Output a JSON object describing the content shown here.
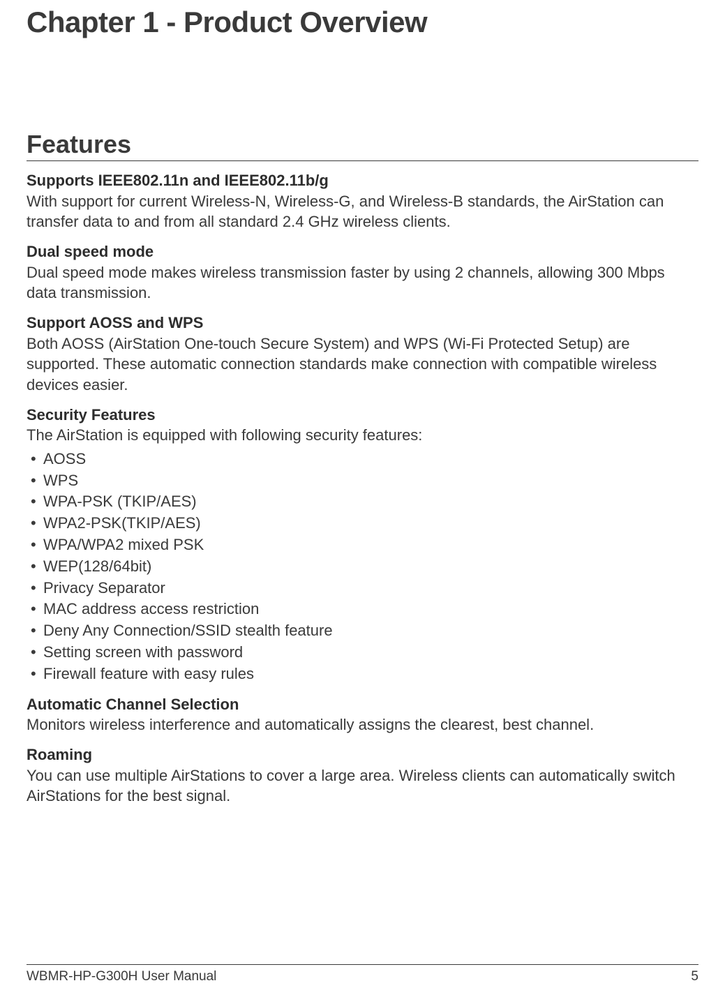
{
  "chapter": {
    "title": "Chapter 1 - Product Overview"
  },
  "section": {
    "title": "Features"
  },
  "features": {
    "f1": {
      "heading": "Supports IEEE802.11n and IEEE802.11b/g",
      "body": "With support for current Wireless-N, Wireless-G, and Wireless-B standards, the AirStation can transfer data to and from all standard 2.4 GHz wireless clients."
    },
    "f2": {
      "heading": "Dual speed mode",
      "body": "Dual speed mode makes wireless transmission faster by using 2 channels, allowing 300 Mbps data transmission."
    },
    "f3": {
      "heading": "Support AOSS and WPS",
      "body": "Both AOSS (AirStation One-touch Secure System) and WPS (Wi-Fi Protected Setup) are supported. These automatic connection standards make connection with compatible wireless devices easier."
    },
    "f4": {
      "heading": "Security Features",
      "body": "The AirStation is equipped with following security features:",
      "items": {
        "0": "AOSS",
        "1": "WPS",
        "2": "WPA-PSK (TKIP/AES)",
        "3": "WPA2-PSK(TKIP/AES)",
        "4": "WPA/WPA2 mixed PSK",
        "5": "WEP(128/64bit)",
        "6": "Privacy Separator",
        "7": "MAC address access restriction",
        "8": "Deny Any Connection/SSID stealth feature",
        "9": "Setting screen with password",
        "10": "Firewall feature with easy rules"
      }
    },
    "f5": {
      "heading": "Automatic Channel Selection",
      "body": "Monitors wireless interference and automatically assigns the clearest, best channel."
    },
    "f6": {
      "heading": "Roaming",
      "body": "You can use multiple AirStations to cover a large area. Wireless clients can automatically switch AirStations for the best signal."
    }
  },
  "footer": {
    "manual": "WBMR-HP-G300H User Manual",
    "page": "5"
  }
}
